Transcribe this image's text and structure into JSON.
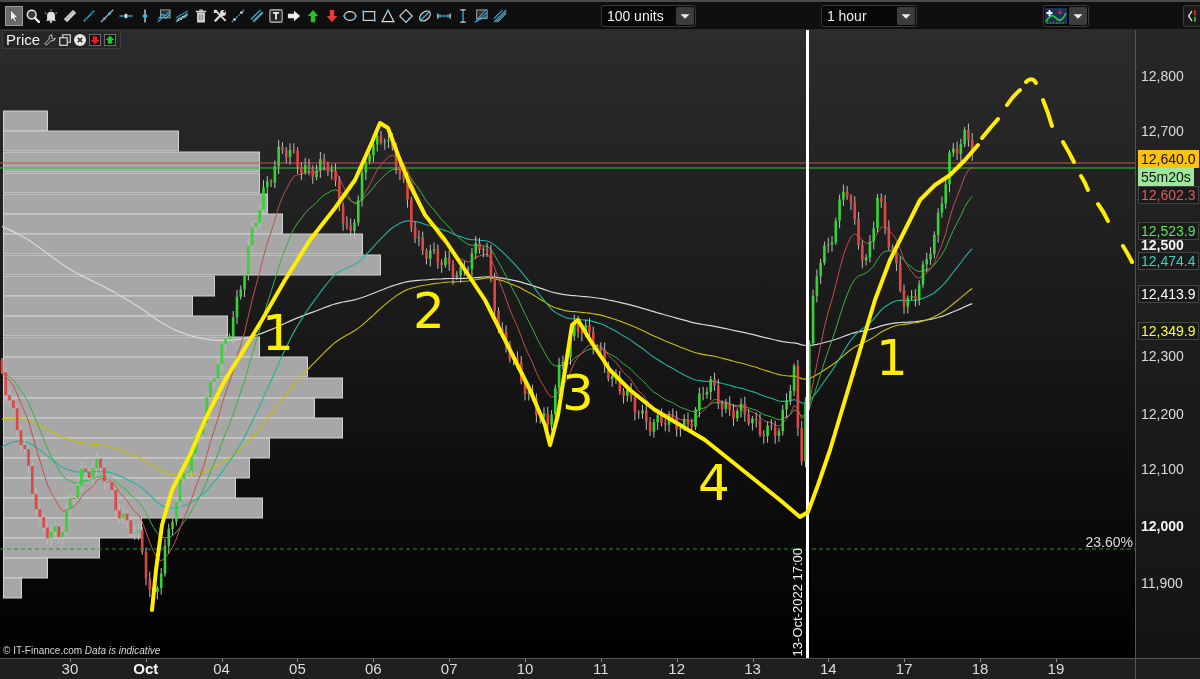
{
  "toolbar": {
    "tools": [
      {
        "kind": "pointer",
        "selected": true
      },
      {
        "kind": "zoom",
        "selected": false
      },
      {
        "kind": "alert",
        "selected": false
      },
      {
        "kind": "ruler",
        "selected": false
      },
      {
        "kind": "segment",
        "selected": false
      },
      {
        "kind": "line",
        "selected": false
      },
      {
        "kind": "horizontal_line",
        "selected": false
      },
      {
        "kind": "vertical_line",
        "selected": false
      },
      {
        "kind": "channel",
        "selected": false
      },
      {
        "kind": "multi_line",
        "selected": false
      },
      {
        "kind": "delete",
        "selected": false
      },
      {
        "kind": "tools",
        "selected": false
      },
      {
        "kind": "dotted_segment",
        "selected": false
      },
      {
        "kind": "parallel_lines",
        "selected": false
      },
      {
        "kind": "text",
        "selected": false
      },
      {
        "kind": "arrow_right",
        "selected": false
      },
      {
        "kind": "arrow_up",
        "selected": false
      },
      {
        "kind": "arrow_down",
        "selected": false
      },
      {
        "kind": "ellipse",
        "selected": false
      },
      {
        "kind": "rectangle",
        "selected": false
      },
      {
        "kind": "triangle",
        "selected": false
      },
      {
        "kind": "diamond",
        "selected": false
      },
      {
        "kind": "crossed_ellipse",
        "selected": false
      },
      {
        "kind": "horizontal_measure",
        "selected": false
      },
      {
        "kind": "vertical_measure",
        "selected": false
      },
      {
        "kind": "fan",
        "selected": false
      },
      {
        "kind": "fan_lines",
        "selected": false
      }
    ],
    "units_dropdown": {
      "value": "100 units"
    },
    "timeframe_dropdown": {
      "value": "1 hour"
    }
  },
  "price_panel": {
    "title": "Price",
    "wave_labels": [
      "1",
      "2",
      "3",
      "4",
      "1"
    ],
    "fibonacci_level": {
      "label": "23.60%"
    },
    "time_marker": {
      "label": "13-Oct-2022 17:00"
    },
    "attribution": "© IT-Finance.com *Data is indicative*"
  },
  "price_axis": {
    "ticks": [
      {
        "label": "12,800",
        "major": false
      },
      {
        "label": "12,700",
        "major": false
      },
      {
        "label": "12,500",
        "major": true
      },
      {
        "label": "12,300",
        "major": false
      },
      {
        "label": "12,200",
        "major": false
      },
      {
        "label": "12,100",
        "major": false
      },
      {
        "label": "12,000",
        "major": true
      },
      {
        "label": "11,900",
        "major": false
      }
    ],
    "markers": [
      {
        "label": "12,640.0",
        "kind": "filled",
        "color": "#ffc20e"
      },
      {
        "label": "55m20s",
        "kind": "filled",
        "color": "#9be89b"
      },
      {
        "label": "12,602.3",
        "kind": "outlined",
        "color": "#e05a5a"
      },
      {
        "label": "12,523.9",
        "kind": "outlined",
        "color": "#5ee05e"
      },
      {
        "label": "12,474.4",
        "kind": "outlined",
        "color": "#2fd6c0"
      },
      {
        "label": "12,413.9",
        "kind": "outlined",
        "color": "#ffffff"
      },
      {
        "label": "12,349.9",
        "kind": "outlined",
        "color": "#ffff33"
      }
    ]
  },
  "time_axis": {
    "labels": [
      {
        "label": "30",
        "major": false
      },
      {
        "label": "Oct",
        "major": true
      },
      {
        "label": "04",
        "major": false
      },
      {
        "label": "05",
        "major": false
      },
      {
        "label": "06",
        "major": false
      },
      {
        "label": "07",
        "major": false
      },
      {
        "label": "10",
        "major": false
      },
      {
        "label": "11",
        "major": false
      },
      {
        "label": "12",
        "major": false
      },
      {
        "label": "13",
        "major": false
      },
      {
        "label": "14",
        "major": false
      },
      {
        "label": "17",
        "major": false
      },
      {
        "label": "18",
        "major": false
      },
      {
        "label": "19",
        "major": false
      }
    ]
  }
}
